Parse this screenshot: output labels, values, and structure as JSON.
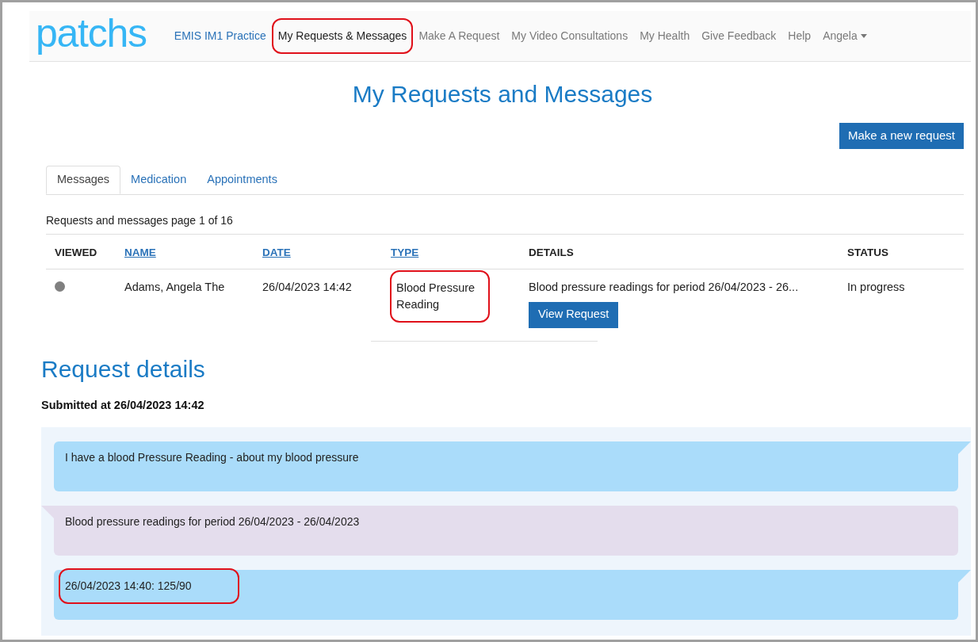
{
  "logo": {
    "text": "patchs"
  },
  "nav": {
    "items": [
      {
        "label": "EMIS IM1 Practice",
        "kind": "practice",
        "selected": false,
        "highlighted": false
      },
      {
        "label": "My Requests & Messages",
        "kind": "link",
        "selected": true,
        "highlighted": true
      },
      {
        "label": "Make A Request",
        "kind": "link",
        "selected": false,
        "highlighted": false
      },
      {
        "label": "My Video Consultations",
        "kind": "link",
        "selected": false,
        "highlighted": false
      },
      {
        "label": "My Health",
        "kind": "link",
        "selected": false,
        "highlighted": false
      },
      {
        "label": "Give Feedback",
        "kind": "link",
        "selected": false,
        "highlighted": false
      },
      {
        "label": "Help",
        "kind": "link",
        "selected": false,
        "highlighted": false
      },
      {
        "label": "Angela",
        "kind": "dropdown",
        "selected": false,
        "highlighted": false
      }
    ]
  },
  "page_title": "My Requests and Messages",
  "new_request_button": "Make a new request",
  "tabs": [
    {
      "label": "Messages",
      "selected": true
    },
    {
      "label": "Medication",
      "selected": false
    },
    {
      "label": "Appointments",
      "selected": false
    }
  ],
  "table": {
    "caption": "Requests and messages page 1 of 16",
    "columns": [
      {
        "label": "VIEWED",
        "sortable": false
      },
      {
        "label": "NAME",
        "sortable": true
      },
      {
        "label": "DATE",
        "sortable": true
      },
      {
        "label": "TYPE",
        "sortable": true
      },
      {
        "label": "DETAILS",
        "sortable": false
      },
      {
        "label": "STATUS",
        "sortable": false
      }
    ],
    "rows": [
      {
        "viewed": false,
        "name": "Adams, Angela The",
        "date": "26/04/2023 14:42",
        "type": "Blood Pressure Reading",
        "type_highlighted": true,
        "details": "Blood pressure readings for period 26/04/2023 - 26...",
        "action": "View Request",
        "status": "In progress"
      }
    ]
  },
  "request_details": {
    "title": "Request details",
    "submitted": "Submitted at 26/04/2023 14:42",
    "messages": [
      {
        "kind": "outgoing",
        "text": "I have a blood Pressure Reading - about my blood pressure",
        "highlighted": false
      },
      {
        "kind": "incoming",
        "text": "Blood pressure readings for period 26/04/2023 - 26/04/2023",
        "highlighted": false
      },
      {
        "kind": "outgoing",
        "text": "26/04/2023 14:40: 125/90",
        "highlighted": true
      }
    ]
  }
}
